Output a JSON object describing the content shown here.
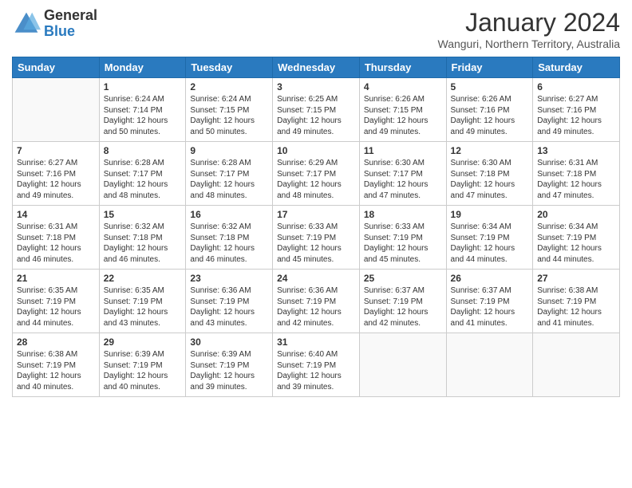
{
  "logo": {
    "general": "General",
    "blue": "Blue"
  },
  "title": "January 2024",
  "subtitle": "Wanguri, Northern Territory, Australia",
  "days_of_week": [
    "Sunday",
    "Monday",
    "Tuesday",
    "Wednesday",
    "Thursday",
    "Friday",
    "Saturday"
  ],
  "weeks": [
    [
      {
        "day": "",
        "empty": true
      },
      {
        "day": "1",
        "sunrise": "6:24 AM",
        "sunset": "7:14 PM",
        "daylight": "12 hours and 50 minutes."
      },
      {
        "day": "2",
        "sunrise": "6:24 AM",
        "sunset": "7:15 PM",
        "daylight": "12 hours and 50 minutes."
      },
      {
        "day": "3",
        "sunrise": "6:25 AM",
        "sunset": "7:15 PM",
        "daylight": "12 hours and 49 minutes."
      },
      {
        "day": "4",
        "sunrise": "6:26 AM",
        "sunset": "7:15 PM",
        "daylight": "12 hours and 49 minutes."
      },
      {
        "day": "5",
        "sunrise": "6:26 AM",
        "sunset": "7:16 PM",
        "daylight": "12 hours and 49 minutes."
      },
      {
        "day": "6",
        "sunrise": "6:27 AM",
        "sunset": "7:16 PM",
        "daylight": "12 hours and 49 minutes."
      }
    ],
    [
      {
        "day": "7",
        "sunrise": "6:27 AM",
        "sunset": "7:16 PM",
        "daylight": "12 hours and 49 minutes."
      },
      {
        "day": "8",
        "sunrise": "6:28 AM",
        "sunset": "7:17 PM",
        "daylight": "12 hours and 48 minutes."
      },
      {
        "day": "9",
        "sunrise": "6:28 AM",
        "sunset": "7:17 PM",
        "daylight": "12 hours and 48 minutes."
      },
      {
        "day": "10",
        "sunrise": "6:29 AM",
        "sunset": "7:17 PM",
        "daylight": "12 hours and 48 minutes."
      },
      {
        "day": "11",
        "sunrise": "6:30 AM",
        "sunset": "7:17 PM",
        "daylight": "12 hours and 47 minutes."
      },
      {
        "day": "12",
        "sunrise": "6:30 AM",
        "sunset": "7:18 PM",
        "daylight": "12 hours and 47 minutes."
      },
      {
        "day": "13",
        "sunrise": "6:31 AM",
        "sunset": "7:18 PM",
        "daylight": "12 hours and 47 minutes."
      }
    ],
    [
      {
        "day": "14",
        "sunrise": "6:31 AM",
        "sunset": "7:18 PM",
        "daylight": "12 hours and 46 minutes."
      },
      {
        "day": "15",
        "sunrise": "6:32 AM",
        "sunset": "7:18 PM",
        "daylight": "12 hours and 46 minutes."
      },
      {
        "day": "16",
        "sunrise": "6:32 AM",
        "sunset": "7:18 PM",
        "daylight": "12 hours and 46 minutes."
      },
      {
        "day": "17",
        "sunrise": "6:33 AM",
        "sunset": "7:19 PM",
        "daylight": "12 hours and 45 minutes."
      },
      {
        "day": "18",
        "sunrise": "6:33 AM",
        "sunset": "7:19 PM",
        "daylight": "12 hours and 45 minutes."
      },
      {
        "day": "19",
        "sunrise": "6:34 AM",
        "sunset": "7:19 PM",
        "daylight": "12 hours and 44 minutes."
      },
      {
        "day": "20",
        "sunrise": "6:34 AM",
        "sunset": "7:19 PM",
        "daylight": "12 hours and 44 minutes."
      }
    ],
    [
      {
        "day": "21",
        "sunrise": "6:35 AM",
        "sunset": "7:19 PM",
        "daylight": "12 hours and 44 minutes."
      },
      {
        "day": "22",
        "sunrise": "6:35 AM",
        "sunset": "7:19 PM",
        "daylight": "12 hours and 43 minutes."
      },
      {
        "day": "23",
        "sunrise": "6:36 AM",
        "sunset": "7:19 PM",
        "daylight": "12 hours and 43 minutes."
      },
      {
        "day": "24",
        "sunrise": "6:36 AM",
        "sunset": "7:19 PM",
        "daylight": "12 hours and 42 minutes."
      },
      {
        "day": "25",
        "sunrise": "6:37 AM",
        "sunset": "7:19 PM",
        "daylight": "12 hours and 42 minutes."
      },
      {
        "day": "26",
        "sunrise": "6:37 AM",
        "sunset": "7:19 PM",
        "daylight": "12 hours and 41 minutes."
      },
      {
        "day": "27",
        "sunrise": "6:38 AM",
        "sunset": "7:19 PM",
        "daylight": "12 hours and 41 minutes."
      }
    ],
    [
      {
        "day": "28",
        "sunrise": "6:38 AM",
        "sunset": "7:19 PM",
        "daylight": "12 hours and 40 minutes."
      },
      {
        "day": "29",
        "sunrise": "6:39 AM",
        "sunset": "7:19 PM",
        "daylight": "12 hours and 40 minutes."
      },
      {
        "day": "30",
        "sunrise": "6:39 AM",
        "sunset": "7:19 PM",
        "daylight": "12 hours and 39 minutes."
      },
      {
        "day": "31",
        "sunrise": "6:40 AM",
        "sunset": "7:19 PM",
        "daylight": "12 hours and 39 minutes."
      },
      {
        "day": "",
        "empty": true
      },
      {
        "day": "",
        "empty": true
      },
      {
        "day": "",
        "empty": true
      }
    ]
  ],
  "labels": {
    "sunrise": "Sunrise:",
    "sunset": "Sunset:",
    "daylight": "Daylight:"
  }
}
